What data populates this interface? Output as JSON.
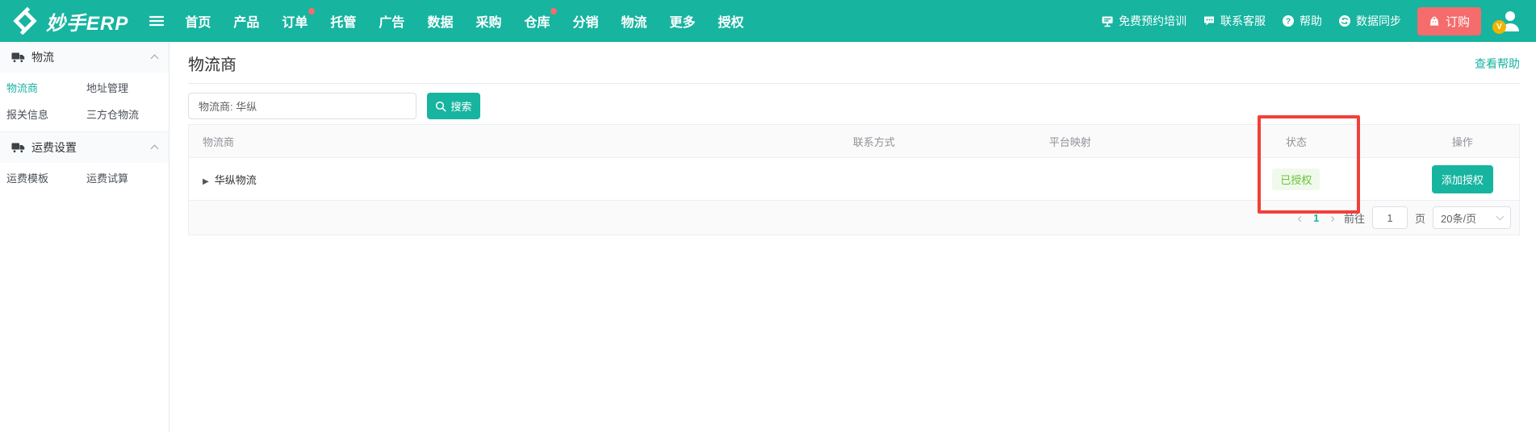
{
  "colors": {
    "brand_teal": "#17b4a0",
    "order_button_red": "#f56c6c",
    "highlight_rect_red": "#f2403a",
    "success_text_green": "#67c23a",
    "success_bg_green": "#f0f9eb"
  },
  "topbar": {
    "logo_text": "妙手ERP",
    "nav": [
      {
        "label": "首页"
      },
      {
        "label": "产品"
      },
      {
        "label": "订单",
        "badge": "dot"
      },
      {
        "label": "托管"
      },
      {
        "label": "广告"
      },
      {
        "label": "数据"
      },
      {
        "label": "采购"
      },
      {
        "label": "仓库",
        "badge": "dot"
      },
      {
        "label": "分销"
      },
      {
        "label": "物流"
      },
      {
        "label": "更多"
      },
      {
        "label": "授权"
      }
    ],
    "training_label": "免费预约培训",
    "support_label": "联系客服",
    "help_label": "帮助",
    "sync_label": "数据同步",
    "order_button_label": "订购",
    "avatar_badge": "V"
  },
  "sidebar": {
    "sections": [
      {
        "title": "物流",
        "items": [
          {
            "label": "物流商",
            "active": true
          },
          {
            "label": "地址管理"
          },
          {
            "label": "报关信息"
          },
          {
            "label": "三方仓物流"
          }
        ]
      },
      {
        "title": "运费设置",
        "items": [
          {
            "label": "运费模板"
          },
          {
            "label": "运费试算"
          }
        ]
      }
    ]
  },
  "main": {
    "title": "物流商",
    "help_link": "查看帮助",
    "search": {
      "value": "物流商: 华纵",
      "button_label": "搜索"
    },
    "table": {
      "columns": [
        "物流商",
        "联系方式",
        "平台映射",
        "状态",
        "操作"
      ],
      "rows": [
        {
          "name": "华纵物流",
          "contact": "",
          "platform_mapping": "",
          "status": "已授权",
          "action": "添加授权"
        }
      ]
    },
    "pagination": {
      "prev": "‹",
      "current_page": "1",
      "next": "›",
      "goto_label": "前往",
      "goto_value": "1",
      "page_unit": "页",
      "page_size": "20条/页"
    }
  }
}
